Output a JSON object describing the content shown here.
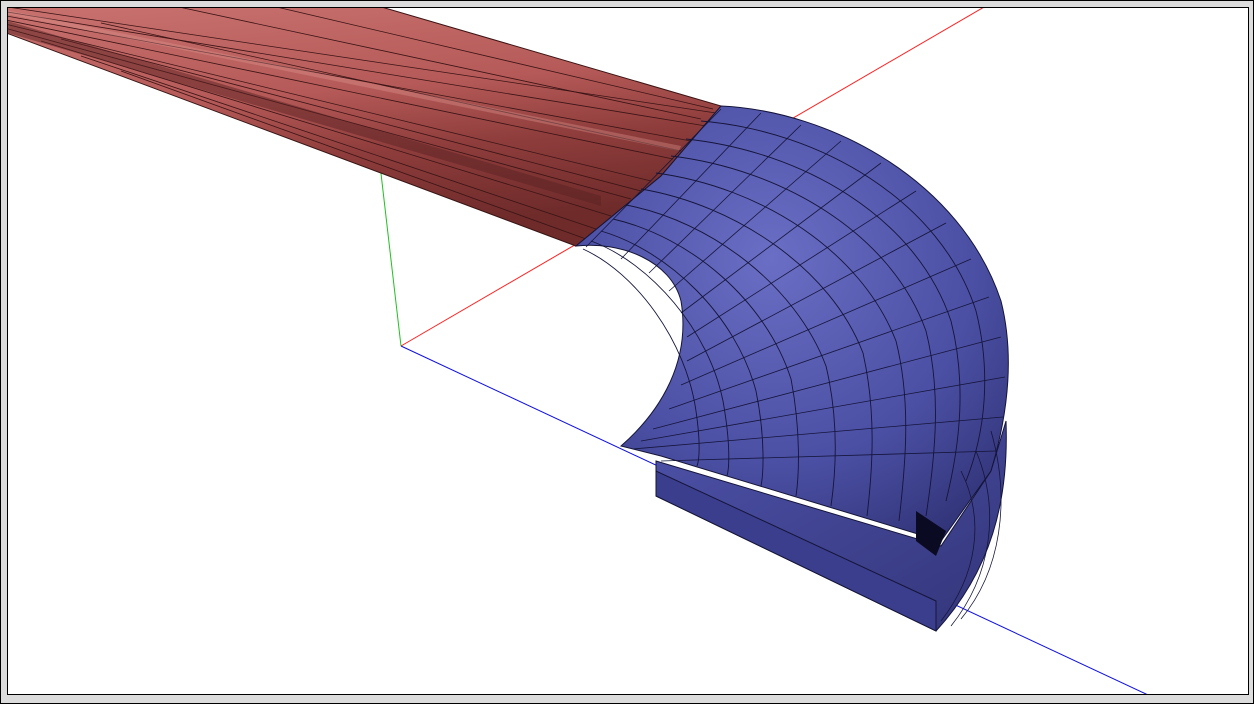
{
  "window": {
    "title": ""
  },
  "viewport": {
    "background_color": "#ffffff",
    "axes": {
      "x_color": "#ff2020",
      "y_color": "#20c020",
      "z_color": "#1010e0"
    },
    "model": {
      "straight_section_color": "#b55a58",
      "selected_corner_color": "#4b4fa3",
      "edge_color": "#1a1a1a"
    }
  }
}
